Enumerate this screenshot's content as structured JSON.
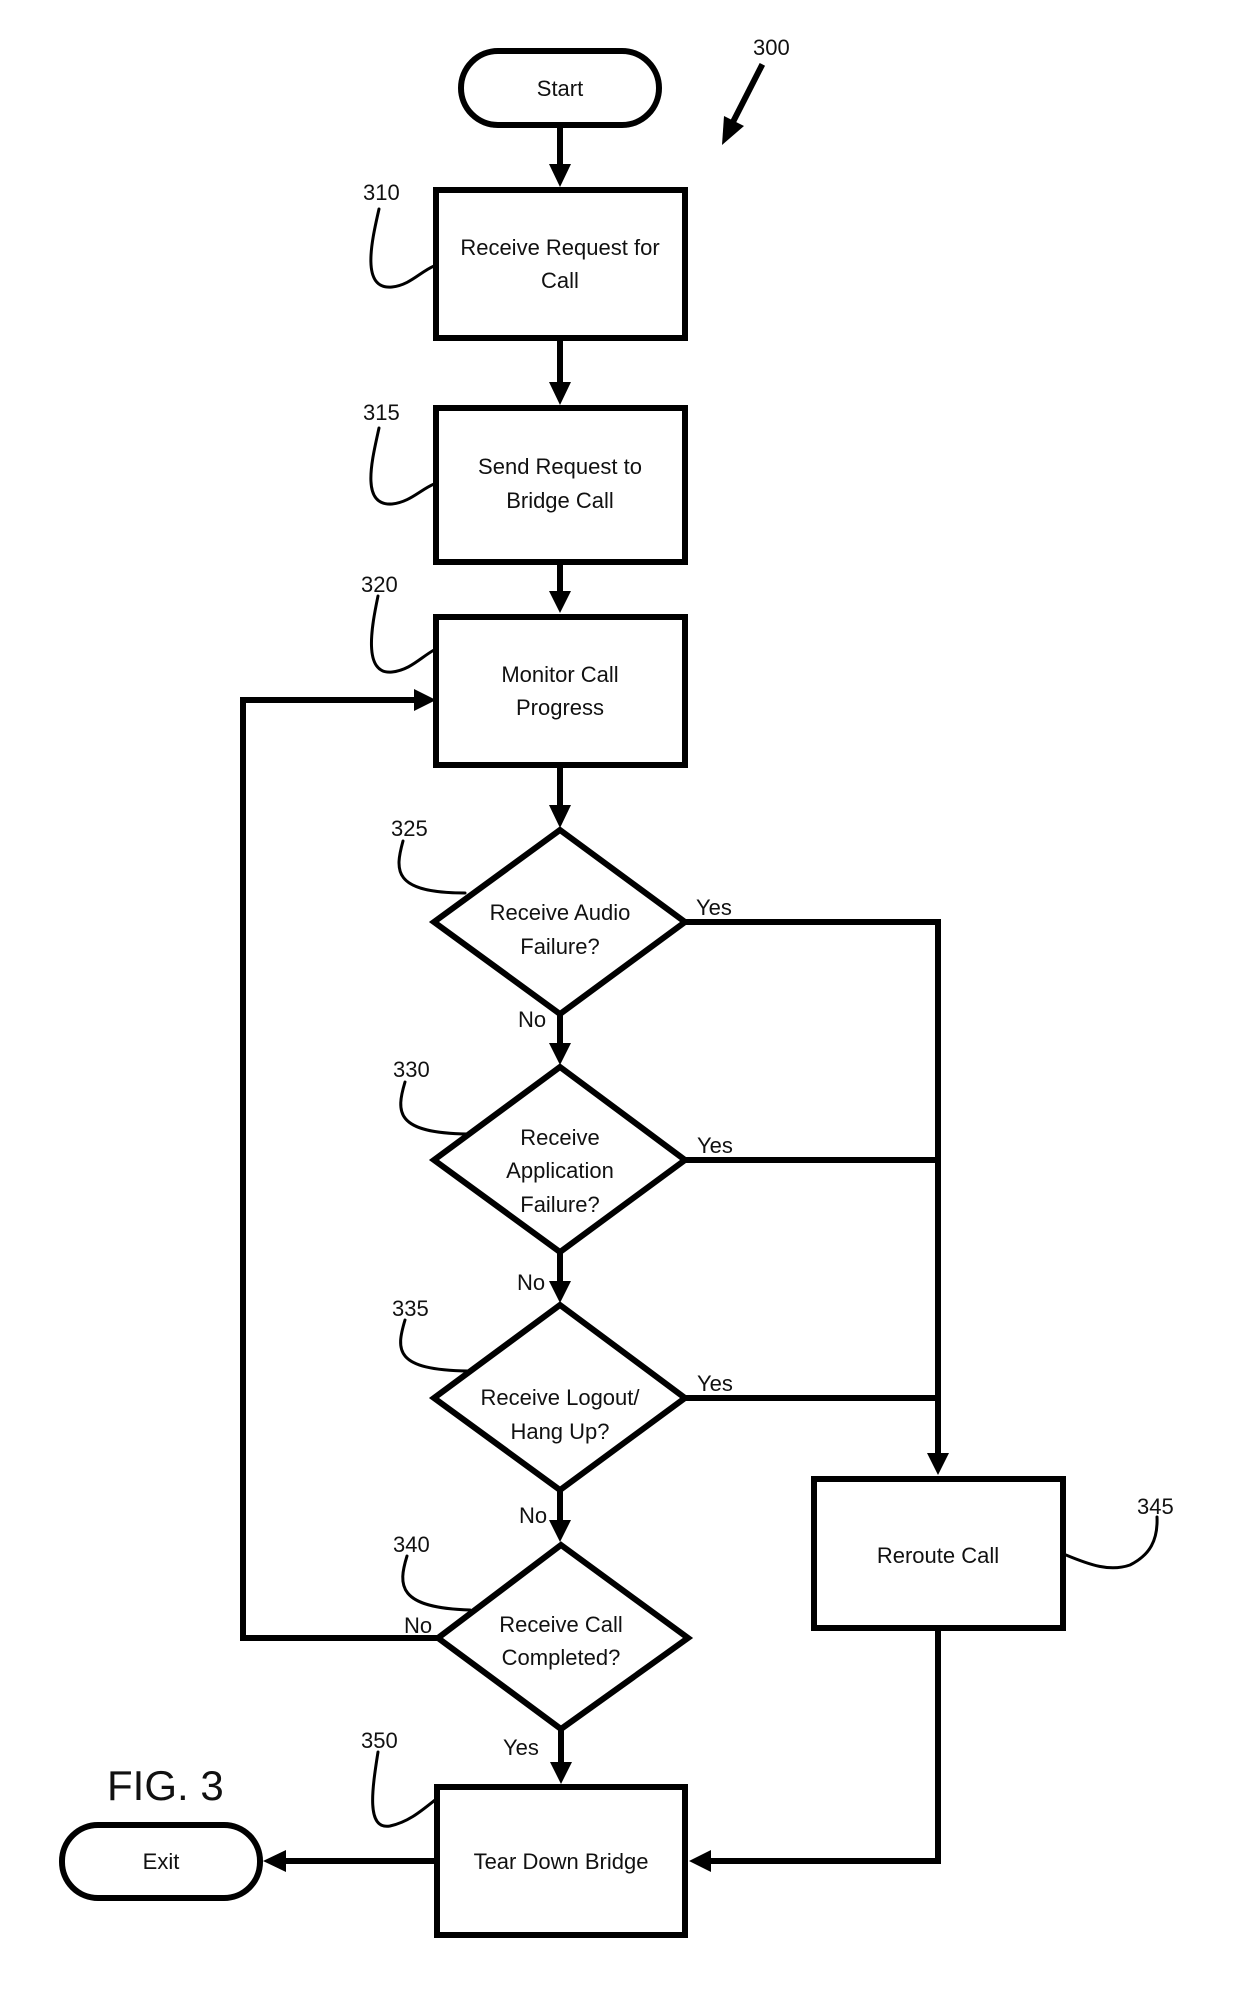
{
  "figure": {
    "label": "FIG. 3",
    "reference": "300"
  },
  "nodes": {
    "start": {
      "label": "Start"
    },
    "n310": {
      "ref": "310",
      "lines": [
        "Receive Request for",
        "Call"
      ]
    },
    "n315": {
      "ref": "315",
      "lines": [
        "Send Request to",
        "Bridge Call"
      ]
    },
    "n320": {
      "ref": "320",
      "lines": [
        "Monitor Call",
        "Progress"
      ]
    },
    "n325": {
      "ref": "325",
      "lines": [
        "Receive Audio",
        "Failure?"
      ],
      "yes": "Yes",
      "no": "No"
    },
    "n330": {
      "ref": "330",
      "lines": [
        "Receive",
        "Application",
        "Failure?"
      ],
      "yes": "Yes",
      "no": "No"
    },
    "n335": {
      "ref": "335",
      "lines": [
        "Receive Logout/",
        "Hang Up?"
      ],
      "yes": "Yes",
      "no": "No"
    },
    "n340": {
      "ref": "340",
      "lines": [
        "Receive Call",
        "Completed?"
      ],
      "yes": "Yes",
      "no": "No"
    },
    "n345": {
      "ref": "345",
      "lines": [
        "Reroute Call"
      ]
    },
    "n350": {
      "ref": "350",
      "lines": [
        "Tear Down Bridge"
      ]
    },
    "exit": {
      "label": "Exit"
    }
  }
}
